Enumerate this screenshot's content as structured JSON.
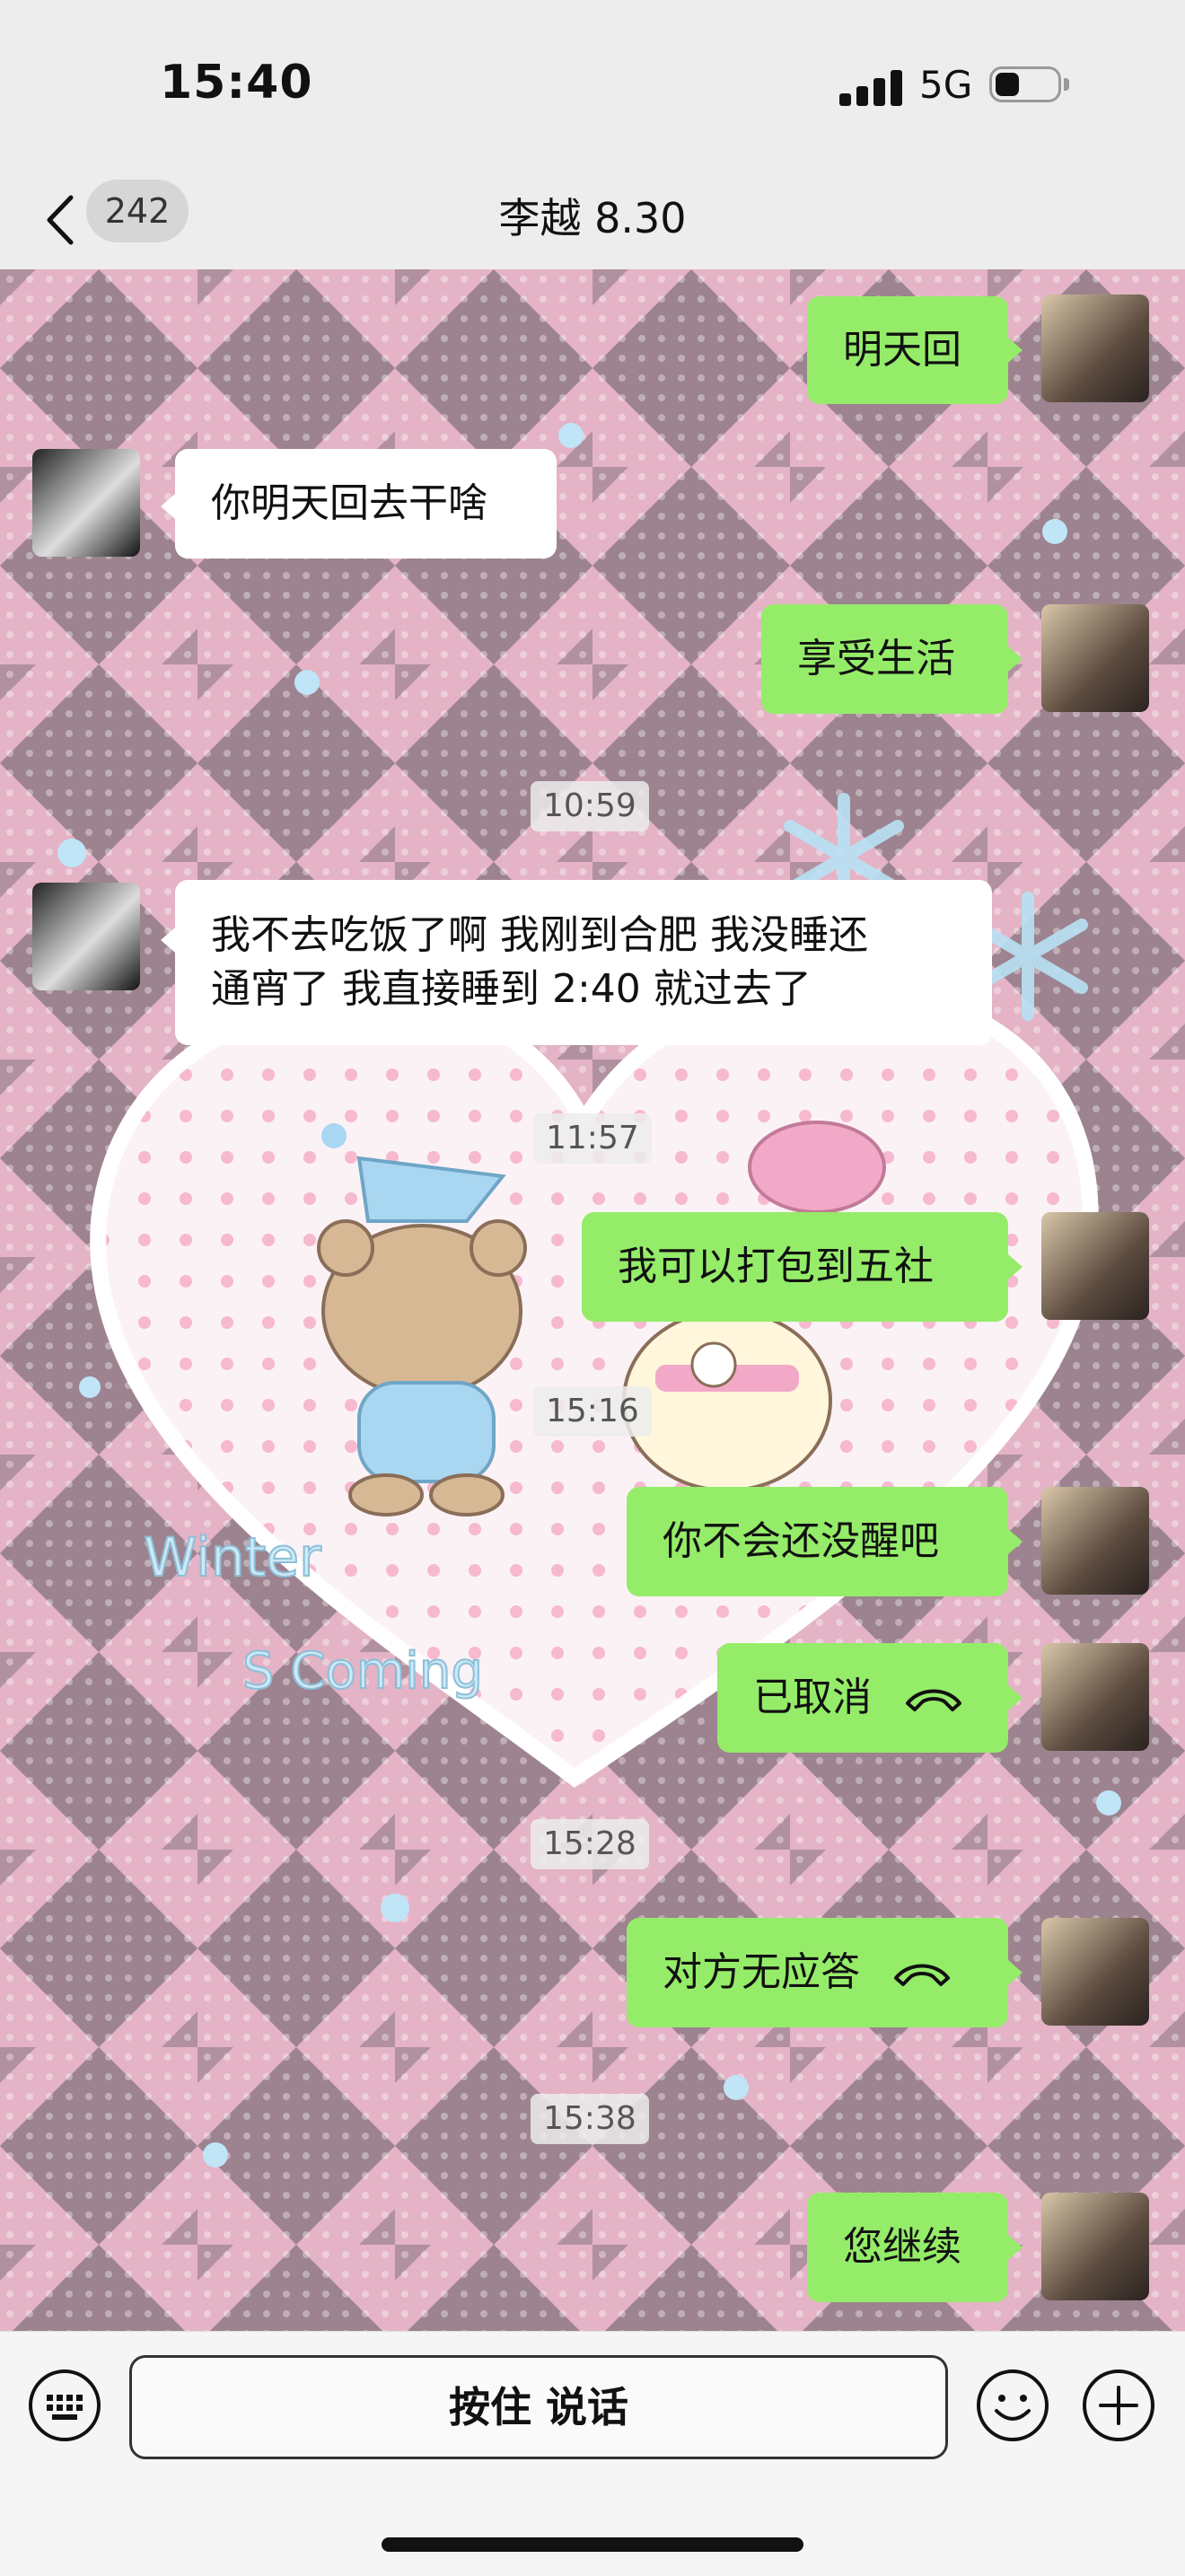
{
  "status_bar": {
    "time": "15:40",
    "network": "5G"
  },
  "nav": {
    "unread_count": "242",
    "title": "李越 8.30"
  },
  "messages": [
    {
      "type": "me",
      "text": "明天回"
    },
    {
      "type": "them",
      "text": "你明天回去干啥"
    },
    {
      "type": "me",
      "text": "享受生活"
    },
    {
      "type": "time",
      "text": "10:59"
    },
    {
      "type": "them",
      "text": "我不去吃饭了啊 我刚到合肥 我没睡还\n通宵了 我直接睡到 2:40 就过去了"
    },
    {
      "type": "time",
      "text": "11:57"
    },
    {
      "type": "me",
      "text": "我可以打包到五社"
    },
    {
      "type": "time",
      "text": "15:16"
    },
    {
      "type": "me",
      "text": "你不会还没醒吧"
    },
    {
      "type": "me_call",
      "text": "已取消"
    },
    {
      "type": "time",
      "text": "15:28"
    },
    {
      "type": "me_call",
      "text": "对方无应答"
    },
    {
      "type": "time",
      "text": "15:38"
    },
    {
      "type": "me",
      "text": "您继续"
    }
  ],
  "wallpaper_text": {
    "line1": "Winter",
    "line2": "S Coming"
  },
  "input_bar": {
    "voice_label": "按住 说话"
  },
  "colors": {
    "me_bubble": "#95ec69",
    "them_bubble": "#ffffff",
    "bg_pink": "#e8b4c8",
    "bg_dark": "#9a8590"
  },
  "icons": [
    "back-icon",
    "more-icon",
    "keyboard-icon",
    "emoji-icon",
    "plus-icon",
    "phone-hangup-icon"
  ]
}
